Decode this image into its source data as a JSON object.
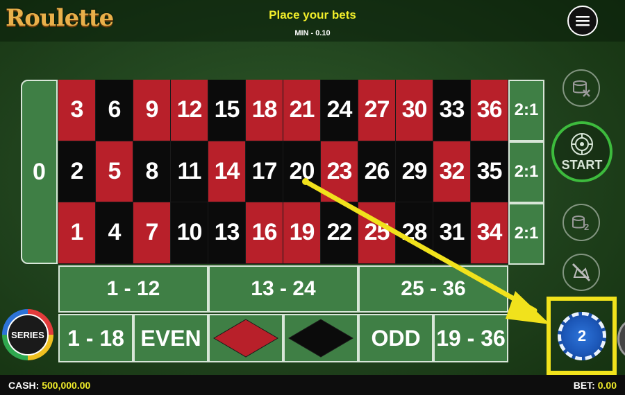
{
  "header": {
    "logo": "Roulette",
    "instruction": "Place your bets",
    "min_bet": "MIN - 0.10",
    "menu_icon": "hamburger-menu-icon"
  },
  "table": {
    "zero": "0",
    "rows": [
      [
        {
          "n": "3",
          "c": "red"
        },
        {
          "n": "6",
          "c": "black"
        },
        {
          "n": "9",
          "c": "red"
        },
        {
          "n": "12",
          "c": "red"
        },
        {
          "n": "15",
          "c": "black"
        },
        {
          "n": "18",
          "c": "red"
        },
        {
          "n": "21",
          "c": "red"
        },
        {
          "n": "24",
          "c": "black"
        },
        {
          "n": "27",
          "c": "red"
        },
        {
          "n": "30",
          "c": "red"
        },
        {
          "n": "33",
          "c": "black"
        },
        {
          "n": "36",
          "c": "red"
        }
      ],
      [
        {
          "n": "2",
          "c": "black"
        },
        {
          "n": "5",
          "c": "red"
        },
        {
          "n": "8",
          "c": "black"
        },
        {
          "n": "11",
          "c": "black"
        },
        {
          "n": "14",
          "c": "red"
        },
        {
          "n": "17",
          "c": "black"
        },
        {
          "n": "20",
          "c": "black"
        },
        {
          "n": "23",
          "c": "red"
        },
        {
          "n": "26",
          "c": "black"
        },
        {
          "n": "29",
          "c": "black"
        },
        {
          "n": "32",
          "c": "red"
        },
        {
          "n": "35",
          "c": "black"
        }
      ],
      [
        {
          "n": "1",
          "c": "red"
        },
        {
          "n": "4",
          "c": "black"
        },
        {
          "n": "7",
          "c": "red"
        },
        {
          "n": "10",
          "c": "black"
        },
        {
          "n": "13",
          "c": "black"
        },
        {
          "n": "16",
          "c": "red"
        },
        {
          "n": "19",
          "c": "red"
        },
        {
          "n": "22",
          "c": "black"
        },
        {
          "n": "25",
          "c": "red"
        },
        {
          "n": "28",
          "c": "black"
        },
        {
          "n": "31",
          "c": "black"
        },
        {
          "n": "34",
          "c": "red"
        }
      ]
    ],
    "columns": [
      "2:1",
      "2:1",
      "2:1"
    ],
    "dozens": [
      "1 - 12",
      "13 - 24",
      "25 - 36"
    ],
    "outside": {
      "low": "1 - 18",
      "even": "EVEN",
      "red_icon": "red-diamond-icon",
      "black_icon": "black-diamond-icon",
      "odd": "ODD",
      "high": "19 - 36"
    }
  },
  "controls": {
    "clear_icon": "clear-bets-icon",
    "start_label": "START",
    "double_icon": "double-bet-icon",
    "rebet_icon": "rebet-disabled-icon",
    "chip_value": "2",
    "series_label": "SERIES"
  },
  "footer": {
    "cash_label": "CASH:",
    "cash_value": "500,000.00",
    "bet_label": "BET:",
    "bet_value": "0.00"
  },
  "colors": {
    "red": "#b8202a",
    "black": "#0b0b0b",
    "felt": "#3f7f45",
    "highlight": "#f1e21c",
    "start_ring": "#3dbb3d"
  }
}
